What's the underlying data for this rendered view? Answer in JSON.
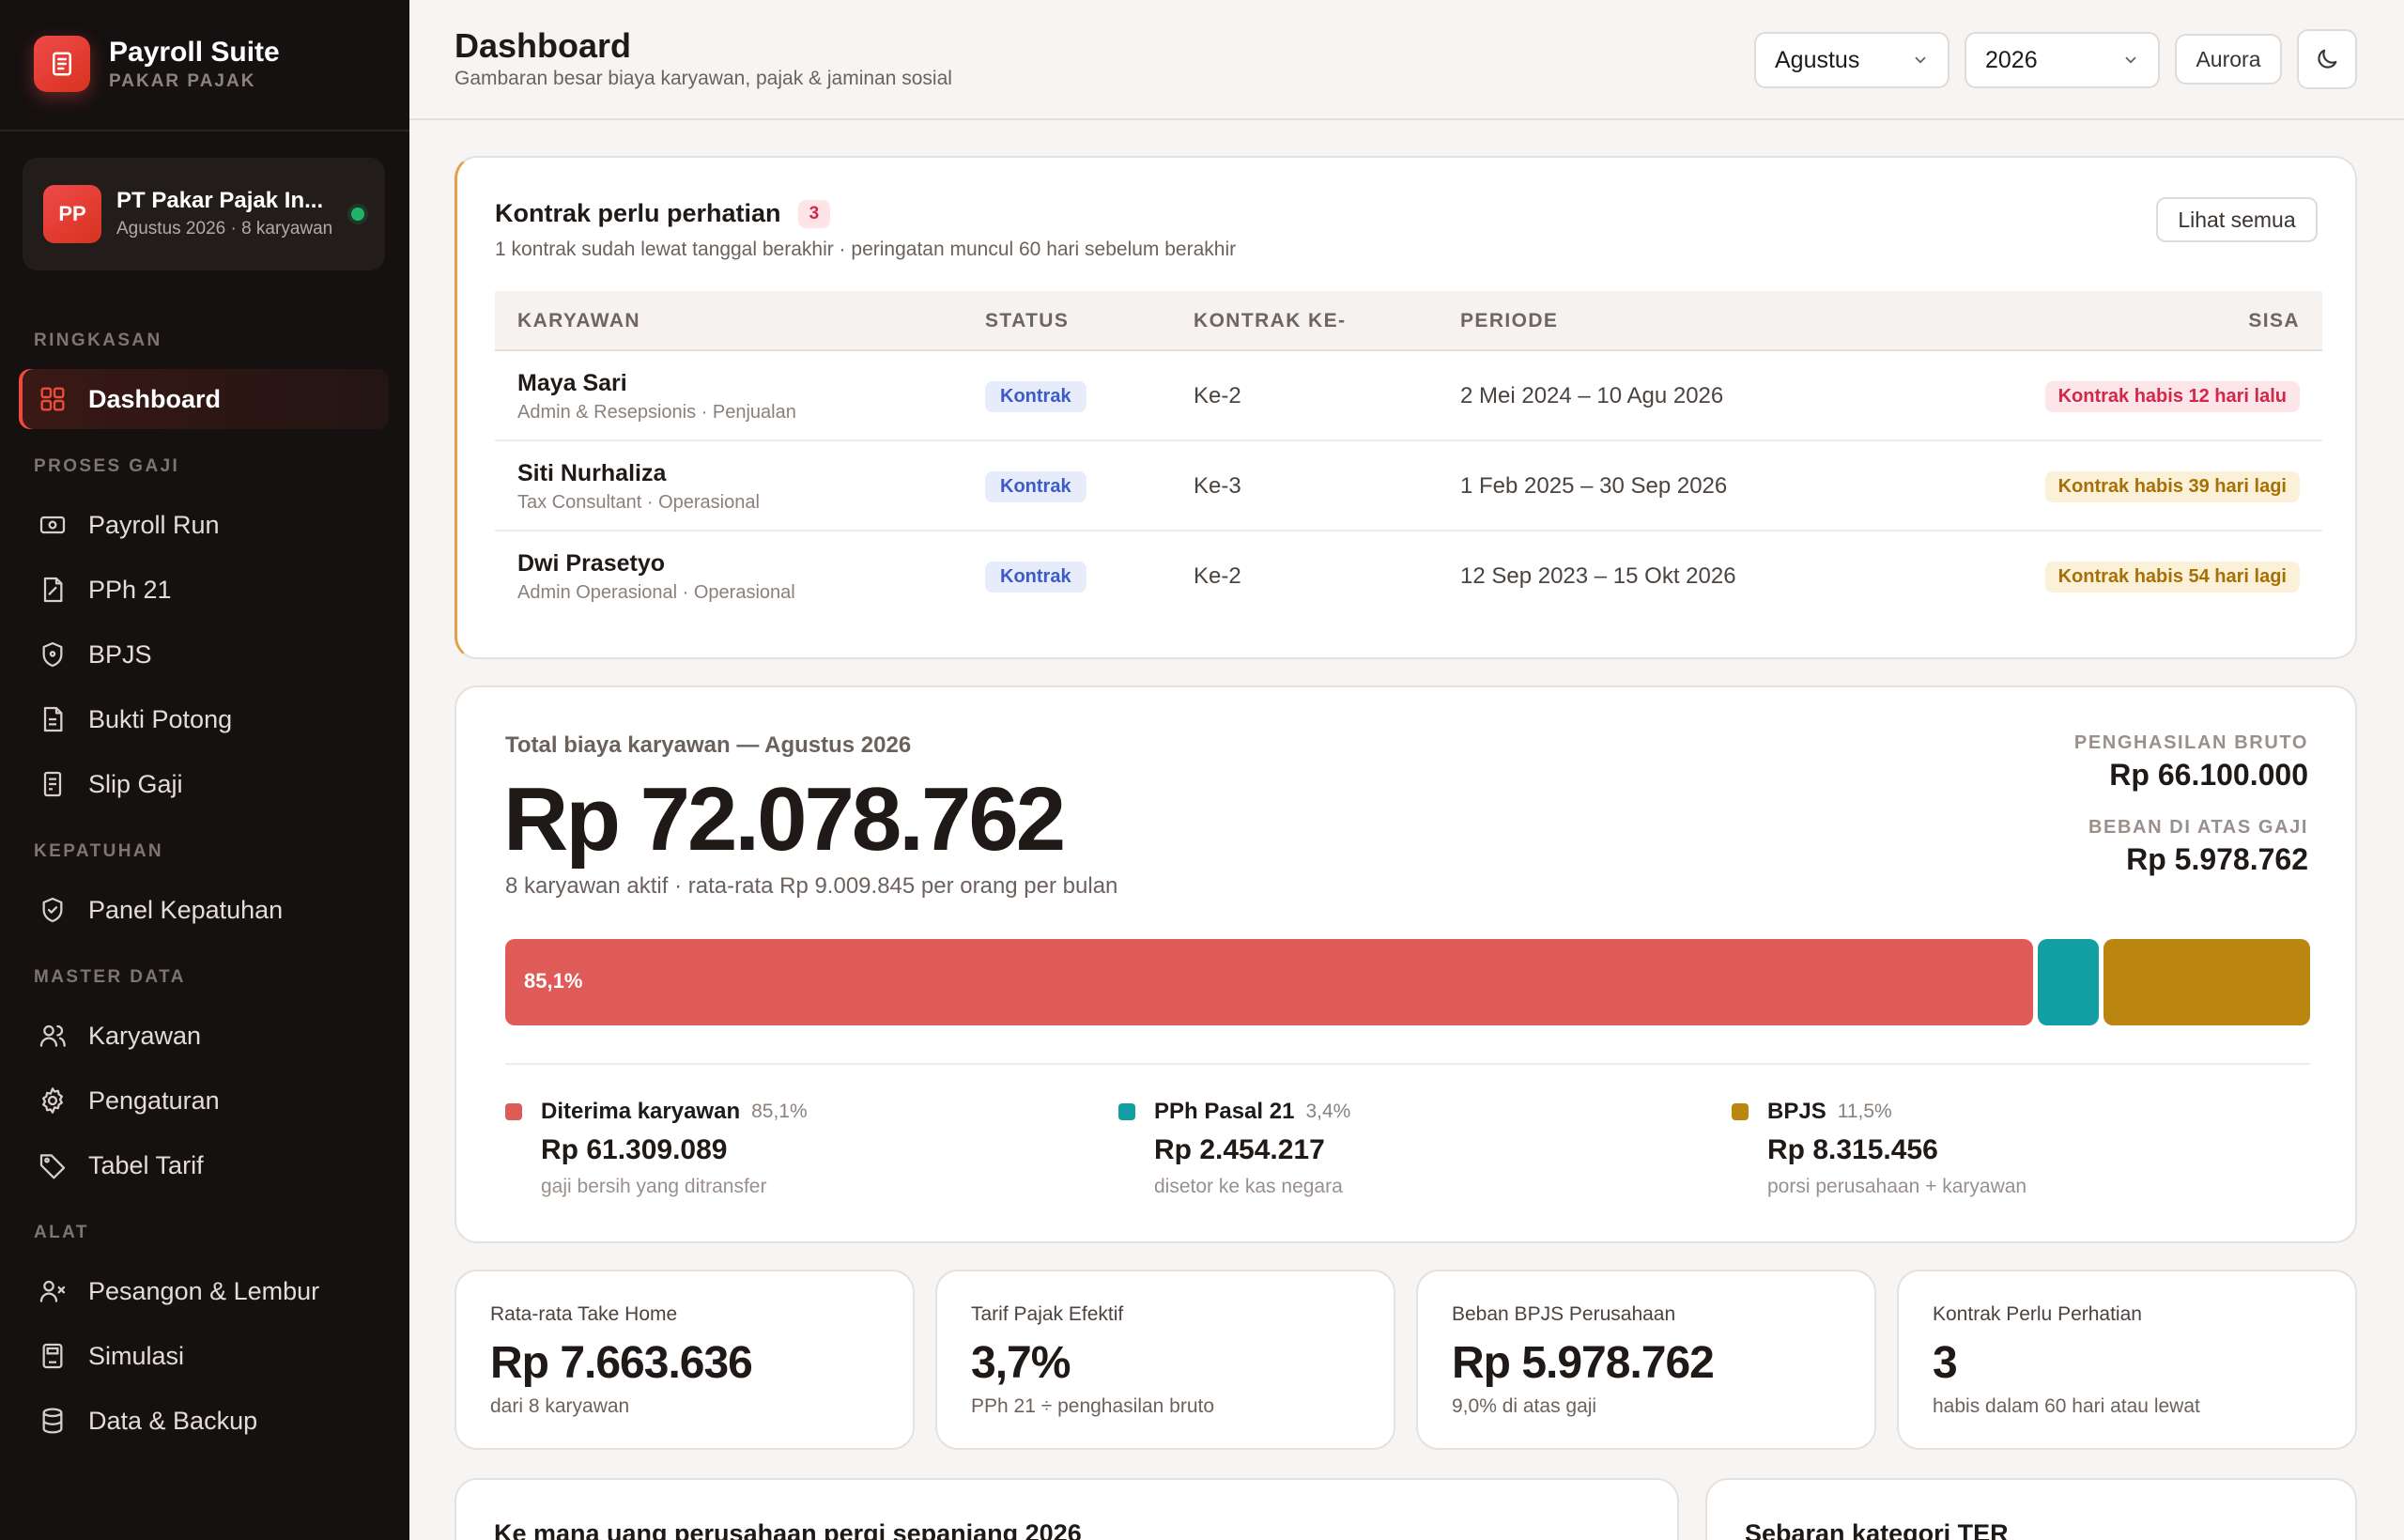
{
  "brand": {
    "title": "Payroll Suite",
    "subtitle": "PAKAR PAJAK"
  },
  "company": {
    "initials": "PP",
    "name": "PT Pakar Pajak In...",
    "meta": "Agustus 2026 · 8 karyawan"
  },
  "nav": {
    "sections": [
      "RINGKASAN",
      "PROSES GAJI",
      "KEPATUHAN",
      "MASTER DATA",
      "ALAT"
    ],
    "items": [
      {
        "label": "Dashboard",
        "icon": "grid-icon"
      },
      {
        "label": "Payroll Run",
        "icon": "cash-icon"
      },
      {
        "label": "PPh 21",
        "icon": "tax-doc-icon"
      },
      {
        "label": "BPJS",
        "icon": "shield-icon"
      },
      {
        "label": "Bukti Potong",
        "icon": "document-icon"
      },
      {
        "label": "Slip Gaji",
        "icon": "receipt-icon"
      },
      {
        "label": "Panel Kepatuhan",
        "icon": "shield-check-icon"
      },
      {
        "label": "Karyawan",
        "icon": "users-icon"
      },
      {
        "label": "Pengaturan",
        "icon": "gear-icon"
      },
      {
        "label": "Tabel Tarif",
        "icon": "tag-icon"
      },
      {
        "label": "Pesangon & Lembur",
        "icon": "user-x-icon"
      },
      {
        "label": "Simulasi",
        "icon": "calculator-icon"
      },
      {
        "label": "Data & Backup",
        "icon": "database-icon"
      }
    ]
  },
  "header": {
    "title": "Dashboard",
    "subtitle": "Gambaran besar biaya karyawan, pajak & jaminan sosial",
    "month": "Agustus",
    "year": "2026",
    "theme_button": "Aurora"
  },
  "contracts": {
    "title": "Kontrak perlu perhatian",
    "badge": "3",
    "subtitle": "1 kontrak sudah lewat tanggal berakhir · peringatan muncul 60 hari sebelum berakhir",
    "view_all": "Lihat semua",
    "columns": [
      "KARYAWAN",
      "STATUS",
      "KONTRAK KE-",
      "PERIODE",
      "SISA"
    ],
    "rows": [
      {
        "name": "Maya Sari",
        "role": "Admin & Resepsionis · Penjualan",
        "status": "Kontrak",
        "kontrak": "Ke-2",
        "periode": "2 Mei 2024 – 10 Agu 2026",
        "sisa": "Kontrak habis 12 hari lalu"
      },
      {
        "name": "Siti Nurhaliza",
        "role": "Tax Consultant · Operasional",
        "status": "Kontrak",
        "kontrak": "Ke-3",
        "periode": "1 Feb 2025 – 30 Sep 2026",
        "sisa": "Kontrak habis 39 hari lagi"
      },
      {
        "name": "Dwi Prasetyo",
        "role": "Admin Operasional · Operasional",
        "status": "Kontrak",
        "kontrak": "Ke-2",
        "periode": "12 Sep 2023 – 15 Okt 2026",
        "sisa": "Kontrak habis 54 hari lagi"
      }
    ],
    "colors": {
      "overdue_bg": "#fde6e9",
      "overdue_fg": "#d3264b",
      "soon_bg": "#fbf1d8",
      "soon_fg": "#a86f06"
    }
  },
  "cost": {
    "label": "Total biaya karyawan — Agustus 2026",
    "total": "Rp 72.078.762",
    "subtitle": "8 karyawan aktif · rata-rata Rp 9.009.845 per orang per bulan",
    "gross_label": "PENGHASILAN BRUTO",
    "gross_value": "Rp 66.100.000",
    "extra_label": "BEBAN DI ATAS GAJI",
    "extra_value": "Rp 5.978.762",
    "bar_label": "85,1%",
    "segments": [
      {
        "name": "Diterima karyawan",
        "pct_label": "85,1%",
        "share": 0.851,
        "value": "Rp 61.309.089",
        "note": "gaji bersih yang ditransfer",
        "color": "#df5b57"
      },
      {
        "name": "PPh Pasal 21",
        "pct_label": "3,4%",
        "share": 0.034,
        "value": "Rp 2.454.217",
        "note": "disetor ke kas negara",
        "color": "#119fa3"
      },
      {
        "name": "BPJS",
        "pct_label": "11,5%",
        "share": 0.115,
        "value": "Rp 8.315.456",
        "note": "porsi perusahaan + karyawan",
        "color": "#bb860f"
      }
    ]
  },
  "kpis": [
    {
      "label": "Rata-rata Take Home",
      "value": "Rp 7.663.636",
      "sub": "dari 8 karyawan"
    },
    {
      "label": "Tarif Pajak Efektif",
      "value": "3,7%",
      "sub": "PPh 21 ÷ penghasilan bruto"
    },
    {
      "label": "Beban BPJS Perusahaan",
      "value": "Rp 5.978.762",
      "sub": "9,0% di atas gaji"
    },
    {
      "label": "Kontrak Perlu Perhatian",
      "value": "3",
      "sub": "habis dalam 60 hari atau lewat"
    }
  ],
  "bottom": {
    "left_title": "Ke mana uang perusahaan pergi sepanjang 2026",
    "right_title": "Sebaran kategori TER"
  },
  "accent": "#ef4a3c"
}
